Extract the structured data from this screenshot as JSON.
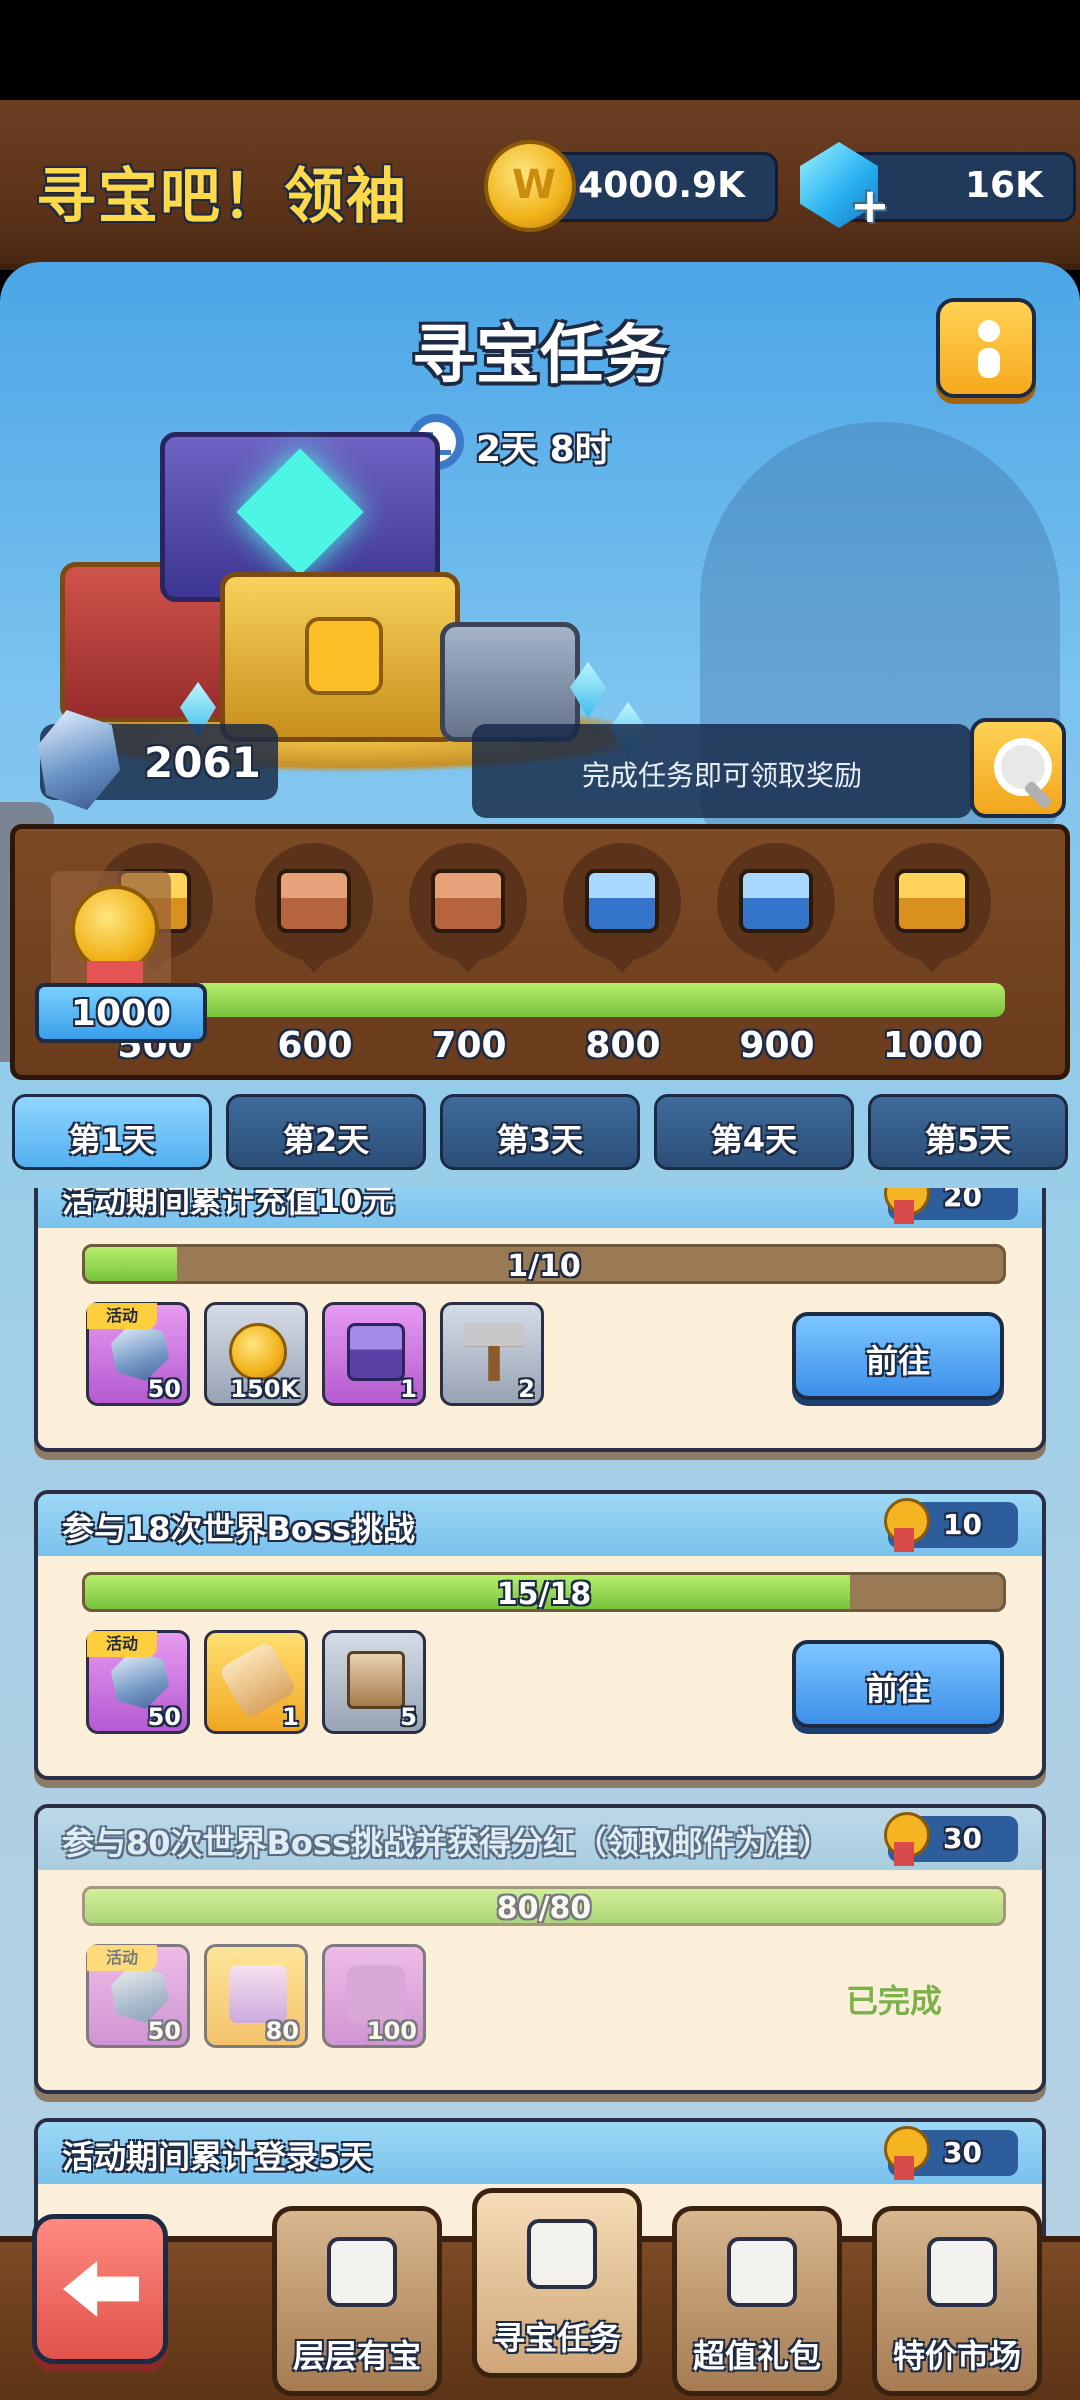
{
  "header": {
    "title": "寻宝吧！领袖",
    "gold": "4000.9K",
    "gems": "16K"
  },
  "main": {
    "title": "寻宝任务",
    "timer": "2天 8时",
    "points": "2061",
    "hint": "完成任务即可领取奖励"
  },
  "track": {
    "current_points": "1000",
    "progress_fraction": 1.0,
    "milestones": [
      {
        "label": "500",
        "chest": "gold"
      },
      {
        "label": "600",
        "chest": "bronze"
      },
      {
        "label": "700",
        "chest": "bronze"
      },
      {
        "label": "800",
        "chest": "blue"
      },
      {
        "label": "900",
        "chest": "blue"
      },
      {
        "label": "1000",
        "chest": "gold"
      }
    ]
  },
  "day_tabs": [
    {
      "label": "第1天",
      "active": true
    },
    {
      "label": "第2天",
      "active": false
    },
    {
      "label": "第3天",
      "active": false
    },
    {
      "label": "第4天",
      "active": false
    },
    {
      "label": "第5天",
      "active": false
    }
  ],
  "tasks": [
    {
      "title": "活动期间累计充值10元",
      "points": "20",
      "progress": "1/10",
      "progress_fraction": 0.1,
      "action": "前往",
      "rewards": [
        {
          "icon": "crystal",
          "qty": "50",
          "tag": "活动",
          "bg": "purple"
        },
        {
          "icon": "coin",
          "qty": "150K",
          "tag": "",
          "bg": "gray"
        },
        {
          "icon": "chest",
          "qty": "1",
          "tag": "",
          "bg": "purple"
        },
        {
          "icon": "hammer",
          "qty": "2",
          "tag": "",
          "bg": "gray"
        }
      ]
    },
    {
      "title": "参与18次世界Boss挑战",
      "points": "10",
      "progress": "15/18",
      "progress_fraction": 0.833,
      "action": "前往",
      "rewards": [
        {
          "icon": "crystal",
          "qty": "50",
          "tag": "活动",
          "bg": "purple"
        },
        {
          "icon": "scroll",
          "qty": "1",
          "tag": "",
          "bg": "orange"
        },
        {
          "icon": "book",
          "qty": "5",
          "tag": "",
          "bg": "gray"
        }
      ]
    },
    {
      "title": "参与80次世界Boss挑战并获得分红（领取邮件为准）",
      "points": "30",
      "progress": "80/80",
      "progress_fraction": 1.0,
      "status": "已完成",
      "rewards": [
        {
          "icon": "crystal",
          "qty": "50",
          "tag": "活动",
          "bg": "purple"
        },
        {
          "icon": "puzzle-gold",
          "qty": "80",
          "tag": "",
          "bg": "orange"
        },
        {
          "icon": "puzzle-purple",
          "qty": "100",
          "tag": "",
          "bg": "purple"
        }
      ]
    },
    {
      "title": "活动期间累计登录5天",
      "points": "30"
    }
  ],
  "bottom_nav": [
    {
      "label": "层层有宝",
      "active": false
    },
    {
      "label": "寻宝任务",
      "active": true
    },
    {
      "label": "超值礼包",
      "active": false
    },
    {
      "label": "特价市场",
      "active": false
    }
  ]
}
